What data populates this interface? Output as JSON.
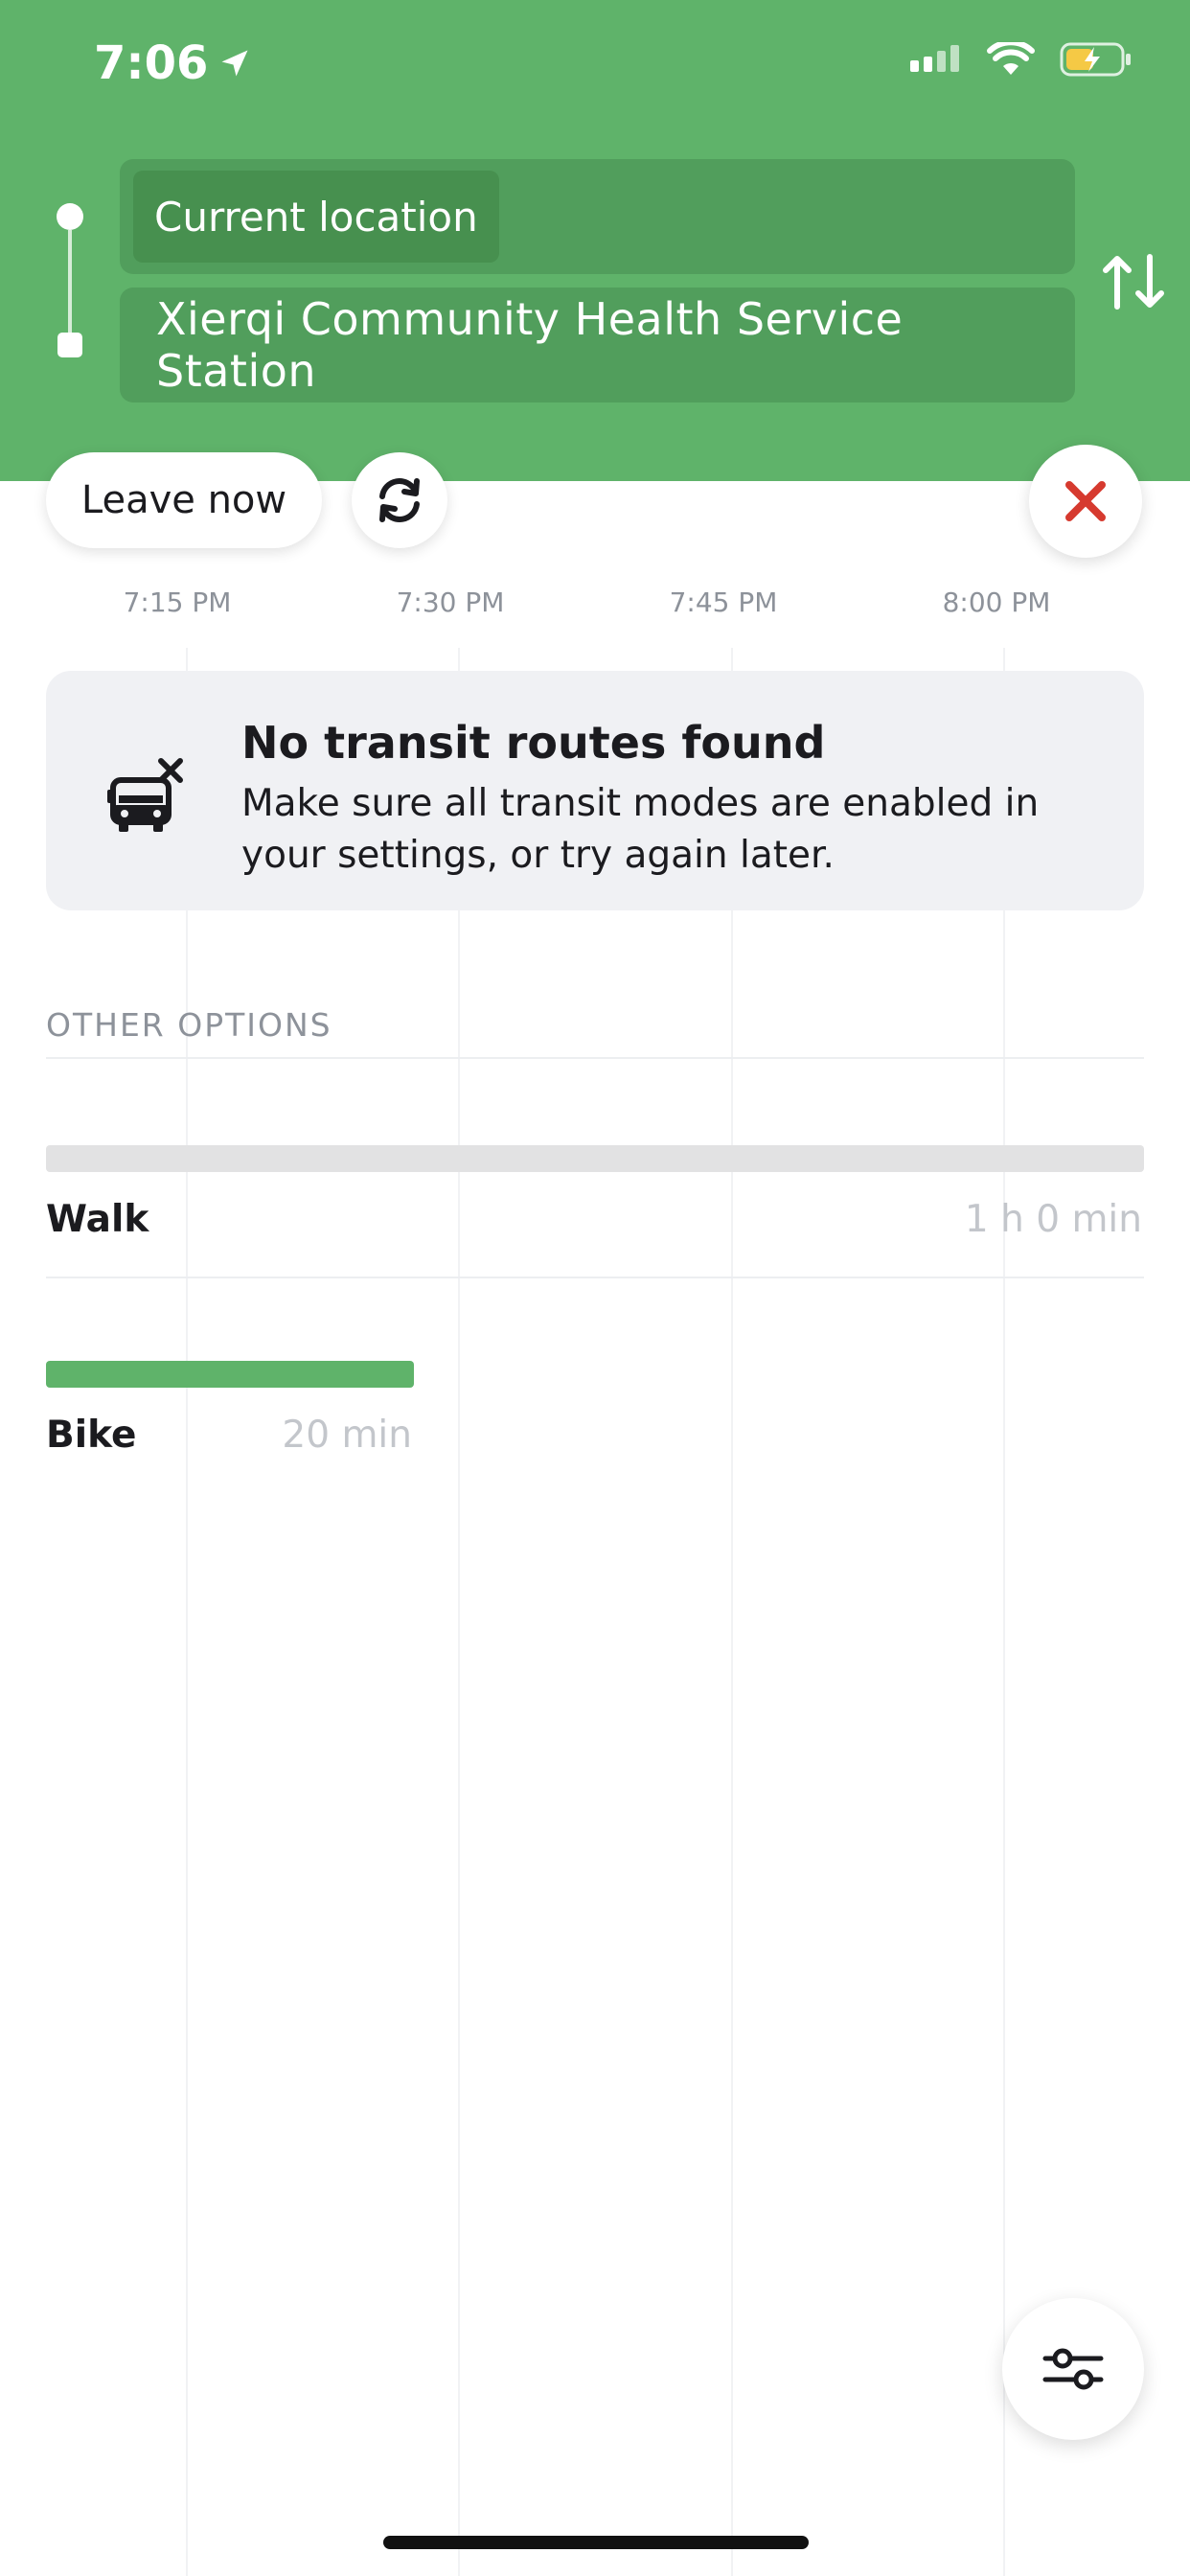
{
  "status_bar": {
    "time": "7:06"
  },
  "route": {
    "from": "Current location",
    "to": "Xierqi Community Health Service Station"
  },
  "controls": {
    "leave_label": "Leave now"
  },
  "timeline": {
    "labels": [
      "7:15 PM",
      "7:30 PM",
      "7:45 PM",
      "8:00 PM"
    ]
  },
  "notice": {
    "title": "No transit routes found",
    "body": "Make sure all transit modes are enabled in your settings, or try again later."
  },
  "other_options": {
    "heading": "OTHER OPTIONS",
    "items": [
      {
        "label": "Walk",
        "duration": "1 h 0 min",
        "bar_color": "#e2e2e3"
      },
      {
        "label": "Bike",
        "duration": "20 min",
        "bar_color": "#5fb36a"
      }
    ]
  },
  "colors": {
    "brand_green": "#5fb36a",
    "close_red": "#d63a2f"
  }
}
